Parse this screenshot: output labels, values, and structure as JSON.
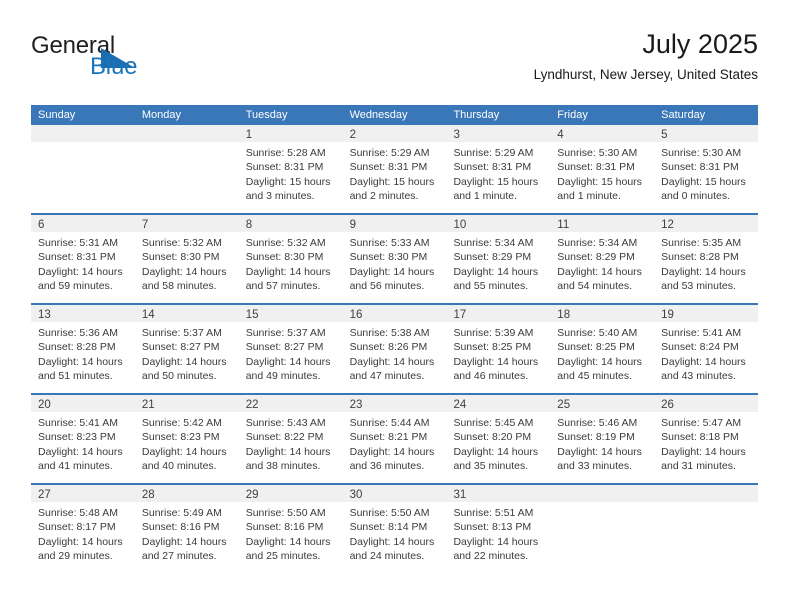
{
  "brand": {
    "name_part1": "General",
    "name_part2": "Blue",
    "triangle_color": "#1b6cb0",
    "blue_color": "#1b75bb"
  },
  "header": {
    "title": "July 2025",
    "subtitle": "Lyndhurst, New Jersey, United States"
  },
  "theme": {
    "header_blue": "#3a77b8",
    "day_band_gray": "#f0f0f0",
    "text_color": "#3b3b3b"
  },
  "weekdays": [
    "Sunday",
    "Monday",
    "Tuesday",
    "Wednesday",
    "Thursday",
    "Friday",
    "Saturday"
  ],
  "weeks": [
    [
      {
        "day": "",
        "sunrise": "",
        "sunset": "",
        "daylight_a": "",
        "daylight_b": ""
      },
      {
        "day": "",
        "sunrise": "",
        "sunset": "",
        "daylight_a": "",
        "daylight_b": ""
      },
      {
        "day": "1",
        "sunrise": "Sunrise: 5:28 AM",
        "sunset": "Sunset: 8:31 PM",
        "daylight_a": "Daylight: 15 hours",
        "daylight_b": "and 3 minutes."
      },
      {
        "day": "2",
        "sunrise": "Sunrise: 5:29 AM",
        "sunset": "Sunset: 8:31 PM",
        "daylight_a": "Daylight: 15 hours",
        "daylight_b": "and 2 minutes."
      },
      {
        "day": "3",
        "sunrise": "Sunrise: 5:29 AM",
        "sunset": "Sunset: 8:31 PM",
        "daylight_a": "Daylight: 15 hours",
        "daylight_b": "and 1 minute."
      },
      {
        "day": "4",
        "sunrise": "Sunrise: 5:30 AM",
        "sunset": "Sunset: 8:31 PM",
        "daylight_a": "Daylight: 15 hours",
        "daylight_b": "and 1 minute."
      },
      {
        "day": "5",
        "sunrise": "Sunrise: 5:30 AM",
        "sunset": "Sunset: 8:31 PM",
        "daylight_a": "Daylight: 15 hours",
        "daylight_b": "and 0 minutes."
      }
    ],
    [
      {
        "day": "6",
        "sunrise": "Sunrise: 5:31 AM",
        "sunset": "Sunset: 8:31 PM",
        "daylight_a": "Daylight: 14 hours",
        "daylight_b": "and 59 minutes."
      },
      {
        "day": "7",
        "sunrise": "Sunrise: 5:32 AM",
        "sunset": "Sunset: 8:30 PM",
        "daylight_a": "Daylight: 14 hours",
        "daylight_b": "and 58 minutes."
      },
      {
        "day": "8",
        "sunrise": "Sunrise: 5:32 AM",
        "sunset": "Sunset: 8:30 PM",
        "daylight_a": "Daylight: 14 hours",
        "daylight_b": "and 57 minutes."
      },
      {
        "day": "9",
        "sunrise": "Sunrise: 5:33 AM",
        "sunset": "Sunset: 8:30 PM",
        "daylight_a": "Daylight: 14 hours",
        "daylight_b": "and 56 minutes."
      },
      {
        "day": "10",
        "sunrise": "Sunrise: 5:34 AM",
        "sunset": "Sunset: 8:29 PM",
        "daylight_a": "Daylight: 14 hours",
        "daylight_b": "and 55 minutes."
      },
      {
        "day": "11",
        "sunrise": "Sunrise: 5:34 AM",
        "sunset": "Sunset: 8:29 PM",
        "daylight_a": "Daylight: 14 hours",
        "daylight_b": "and 54 minutes."
      },
      {
        "day": "12",
        "sunrise": "Sunrise: 5:35 AM",
        "sunset": "Sunset: 8:28 PM",
        "daylight_a": "Daylight: 14 hours",
        "daylight_b": "and 53 minutes."
      }
    ],
    [
      {
        "day": "13",
        "sunrise": "Sunrise: 5:36 AM",
        "sunset": "Sunset: 8:28 PM",
        "daylight_a": "Daylight: 14 hours",
        "daylight_b": "and 51 minutes."
      },
      {
        "day": "14",
        "sunrise": "Sunrise: 5:37 AM",
        "sunset": "Sunset: 8:27 PM",
        "daylight_a": "Daylight: 14 hours",
        "daylight_b": "and 50 minutes."
      },
      {
        "day": "15",
        "sunrise": "Sunrise: 5:37 AM",
        "sunset": "Sunset: 8:27 PM",
        "daylight_a": "Daylight: 14 hours",
        "daylight_b": "and 49 minutes."
      },
      {
        "day": "16",
        "sunrise": "Sunrise: 5:38 AM",
        "sunset": "Sunset: 8:26 PM",
        "daylight_a": "Daylight: 14 hours",
        "daylight_b": "and 47 minutes."
      },
      {
        "day": "17",
        "sunrise": "Sunrise: 5:39 AM",
        "sunset": "Sunset: 8:25 PM",
        "daylight_a": "Daylight: 14 hours",
        "daylight_b": "and 46 minutes."
      },
      {
        "day": "18",
        "sunrise": "Sunrise: 5:40 AM",
        "sunset": "Sunset: 8:25 PM",
        "daylight_a": "Daylight: 14 hours",
        "daylight_b": "and 45 minutes."
      },
      {
        "day": "19",
        "sunrise": "Sunrise: 5:41 AM",
        "sunset": "Sunset: 8:24 PM",
        "daylight_a": "Daylight: 14 hours",
        "daylight_b": "and 43 minutes."
      }
    ],
    [
      {
        "day": "20",
        "sunrise": "Sunrise: 5:41 AM",
        "sunset": "Sunset: 8:23 PM",
        "daylight_a": "Daylight: 14 hours",
        "daylight_b": "and 41 minutes."
      },
      {
        "day": "21",
        "sunrise": "Sunrise: 5:42 AM",
        "sunset": "Sunset: 8:23 PM",
        "daylight_a": "Daylight: 14 hours",
        "daylight_b": "and 40 minutes."
      },
      {
        "day": "22",
        "sunrise": "Sunrise: 5:43 AM",
        "sunset": "Sunset: 8:22 PM",
        "daylight_a": "Daylight: 14 hours",
        "daylight_b": "and 38 minutes."
      },
      {
        "day": "23",
        "sunrise": "Sunrise: 5:44 AM",
        "sunset": "Sunset: 8:21 PM",
        "daylight_a": "Daylight: 14 hours",
        "daylight_b": "and 36 minutes."
      },
      {
        "day": "24",
        "sunrise": "Sunrise: 5:45 AM",
        "sunset": "Sunset: 8:20 PM",
        "daylight_a": "Daylight: 14 hours",
        "daylight_b": "and 35 minutes."
      },
      {
        "day": "25",
        "sunrise": "Sunrise: 5:46 AM",
        "sunset": "Sunset: 8:19 PM",
        "daylight_a": "Daylight: 14 hours",
        "daylight_b": "and 33 minutes."
      },
      {
        "day": "26",
        "sunrise": "Sunrise: 5:47 AM",
        "sunset": "Sunset: 8:18 PM",
        "daylight_a": "Daylight: 14 hours",
        "daylight_b": "and 31 minutes."
      }
    ],
    [
      {
        "day": "27",
        "sunrise": "Sunrise: 5:48 AM",
        "sunset": "Sunset: 8:17 PM",
        "daylight_a": "Daylight: 14 hours",
        "daylight_b": "and 29 minutes."
      },
      {
        "day": "28",
        "sunrise": "Sunrise: 5:49 AM",
        "sunset": "Sunset: 8:16 PM",
        "daylight_a": "Daylight: 14 hours",
        "daylight_b": "and 27 minutes."
      },
      {
        "day": "29",
        "sunrise": "Sunrise: 5:50 AM",
        "sunset": "Sunset: 8:16 PM",
        "daylight_a": "Daylight: 14 hours",
        "daylight_b": "and 25 minutes."
      },
      {
        "day": "30",
        "sunrise": "Sunrise: 5:50 AM",
        "sunset": "Sunset: 8:14 PM",
        "daylight_a": "Daylight: 14 hours",
        "daylight_b": "and 24 minutes."
      },
      {
        "day": "31",
        "sunrise": "Sunrise: 5:51 AM",
        "sunset": "Sunset: 8:13 PM",
        "daylight_a": "Daylight: 14 hours",
        "daylight_b": "and 22 minutes."
      },
      {
        "day": "",
        "sunrise": "",
        "sunset": "",
        "daylight_a": "",
        "daylight_b": ""
      },
      {
        "day": "",
        "sunrise": "",
        "sunset": "",
        "daylight_a": "",
        "daylight_b": ""
      }
    ]
  ]
}
